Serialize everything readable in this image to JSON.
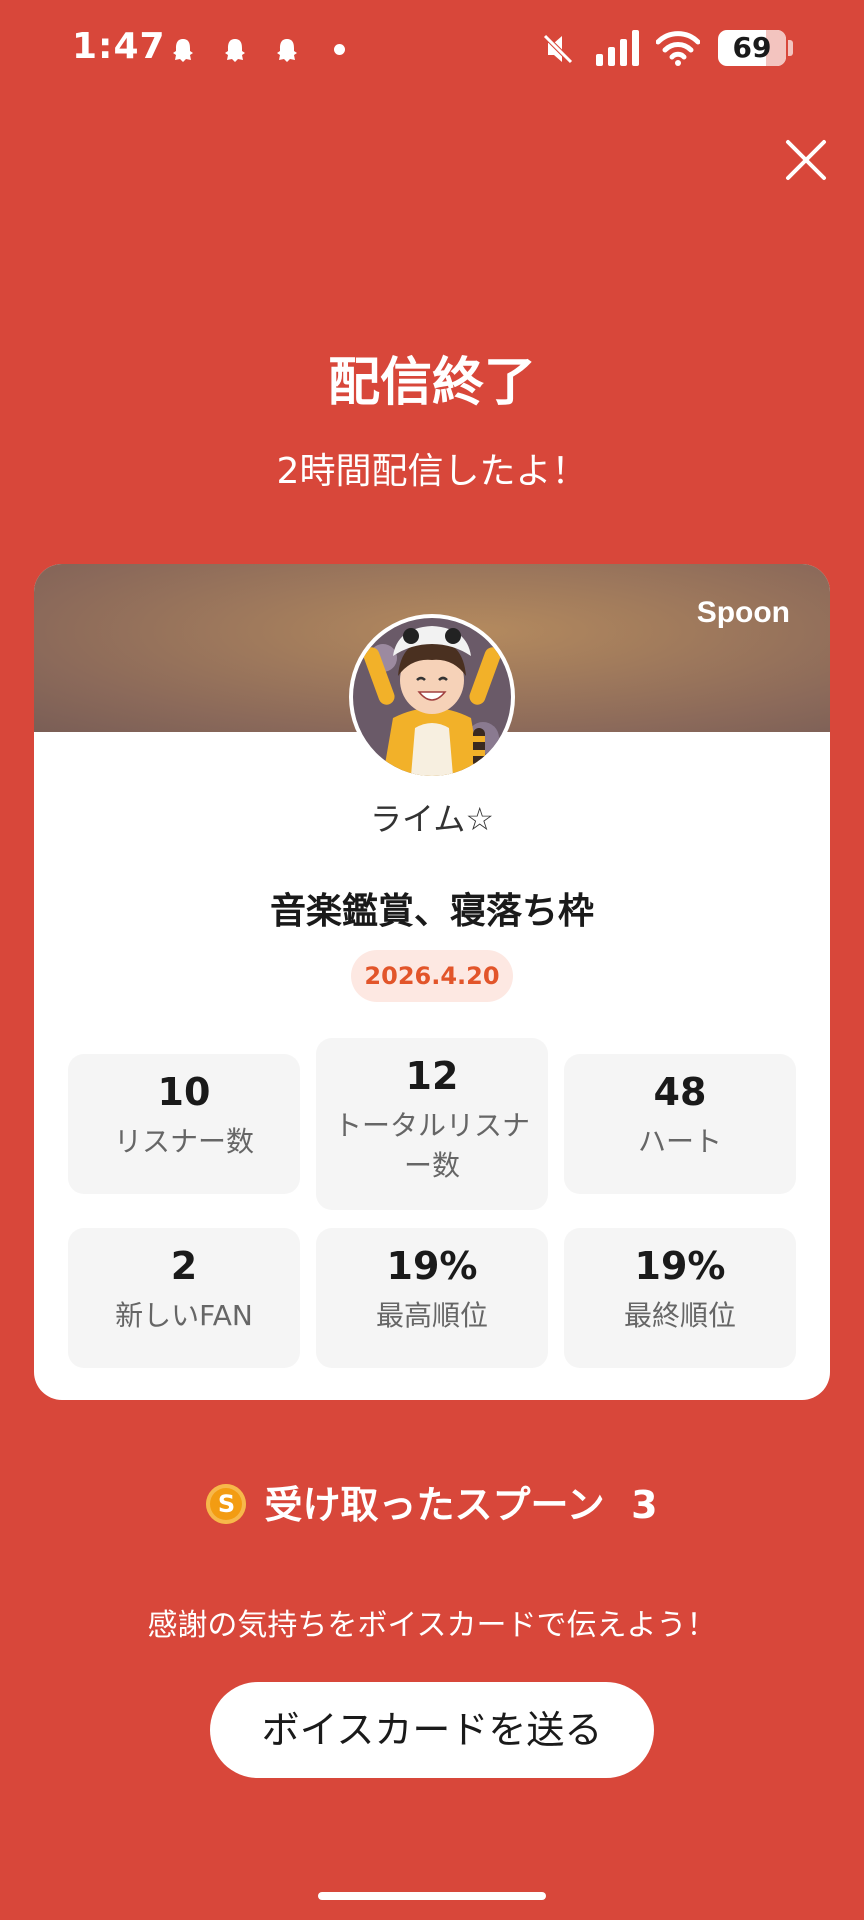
{
  "status_bar": {
    "time": "1:47",
    "battery": "69"
  },
  "header": {
    "title": "配信終了",
    "subtitle": "2時間配信したよ！"
  },
  "card": {
    "brand": "Spoon",
    "username": "ライム☆",
    "stream_title": "音楽鑑賞、寝落ち枠",
    "date": "2026.4.20",
    "stats": [
      {
        "value": "10",
        "label": "リスナー数"
      },
      {
        "value": "12",
        "label": "トータルリスナー数"
      },
      {
        "value": "48",
        "label": "ハート"
      },
      {
        "value": "2",
        "label": "新しいFAN"
      },
      {
        "value": "19%",
        "label": "最高順位"
      },
      {
        "value": "19%",
        "label": "最終順位"
      }
    ]
  },
  "spoons": {
    "coin_symbol": "S",
    "label": "受け取ったスプーン",
    "count": "3"
  },
  "footer": {
    "message": "感謝の気持ちをボイスカードで伝えよう！",
    "button_label": "ボイスカードを送る"
  },
  "colors": {
    "background": "#d8473a",
    "accent": "#e2552a",
    "coin": "#f39c12"
  }
}
